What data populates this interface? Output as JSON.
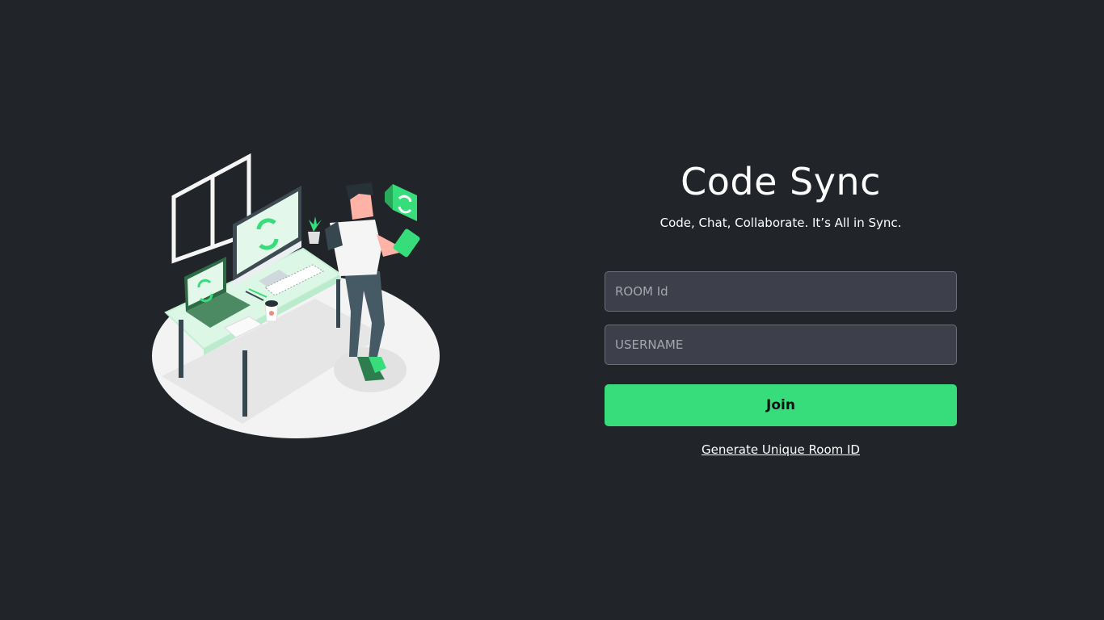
{
  "app": {
    "title": "Code Sync",
    "tagline": "Code, Chat, Collaborate. It’s All in Sync."
  },
  "form": {
    "room_id_placeholder": "ROOM Id",
    "room_id_value": "",
    "username_placeholder": "USERNAME",
    "username_value": "",
    "join_label": "Join",
    "generate_link_label": "Generate Unique Room ID"
  },
  "illustration": {
    "icon": "developer-at-desk-illustration",
    "accent_color": "#37dd7a"
  },
  "colors": {
    "background": "#212429",
    "input_background": "#3d3f4a",
    "accent": "#37dd7a",
    "text": "#ffffff"
  }
}
